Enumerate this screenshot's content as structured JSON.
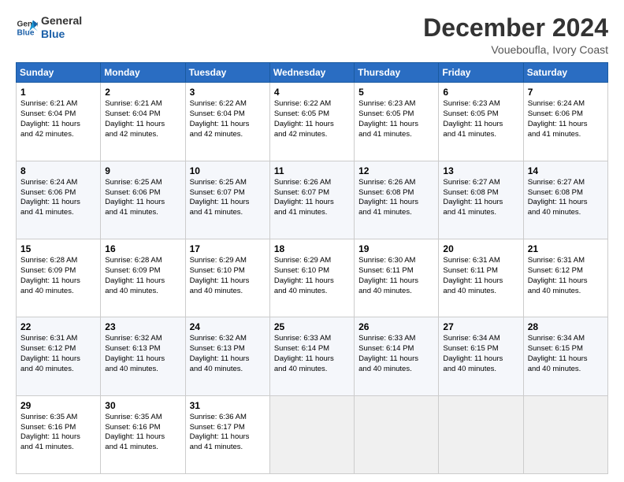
{
  "logo": {
    "line1": "General",
    "line2": "Blue"
  },
  "title": "December 2024",
  "subtitle": "Voueboufla, Ivory Coast",
  "header_days": [
    "Sunday",
    "Monday",
    "Tuesday",
    "Wednesday",
    "Thursday",
    "Friday",
    "Saturday"
  ],
  "weeks": [
    [
      {
        "day": "1",
        "lines": [
          "Sunrise: 6:21 AM",
          "Sunset: 6:04 PM",
          "Daylight: 11 hours",
          "and 42 minutes."
        ]
      },
      {
        "day": "2",
        "lines": [
          "Sunrise: 6:21 AM",
          "Sunset: 6:04 PM",
          "Daylight: 11 hours",
          "and 42 minutes."
        ]
      },
      {
        "day": "3",
        "lines": [
          "Sunrise: 6:22 AM",
          "Sunset: 6:04 PM",
          "Daylight: 11 hours",
          "and 42 minutes."
        ]
      },
      {
        "day": "4",
        "lines": [
          "Sunrise: 6:22 AM",
          "Sunset: 6:05 PM",
          "Daylight: 11 hours",
          "and 42 minutes."
        ]
      },
      {
        "day": "5",
        "lines": [
          "Sunrise: 6:23 AM",
          "Sunset: 6:05 PM",
          "Daylight: 11 hours",
          "and 41 minutes."
        ]
      },
      {
        "day": "6",
        "lines": [
          "Sunrise: 6:23 AM",
          "Sunset: 6:05 PM",
          "Daylight: 11 hours",
          "and 41 minutes."
        ]
      },
      {
        "day": "7",
        "lines": [
          "Sunrise: 6:24 AM",
          "Sunset: 6:06 PM",
          "Daylight: 11 hours",
          "and 41 minutes."
        ]
      }
    ],
    [
      {
        "day": "8",
        "lines": [
          "Sunrise: 6:24 AM",
          "Sunset: 6:06 PM",
          "Daylight: 11 hours",
          "and 41 minutes."
        ]
      },
      {
        "day": "9",
        "lines": [
          "Sunrise: 6:25 AM",
          "Sunset: 6:06 PM",
          "Daylight: 11 hours",
          "and 41 minutes."
        ]
      },
      {
        "day": "10",
        "lines": [
          "Sunrise: 6:25 AM",
          "Sunset: 6:07 PM",
          "Daylight: 11 hours",
          "and 41 minutes."
        ]
      },
      {
        "day": "11",
        "lines": [
          "Sunrise: 6:26 AM",
          "Sunset: 6:07 PM",
          "Daylight: 11 hours",
          "and 41 minutes."
        ]
      },
      {
        "day": "12",
        "lines": [
          "Sunrise: 6:26 AM",
          "Sunset: 6:08 PM",
          "Daylight: 11 hours",
          "and 41 minutes."
        ]
      },
      {
        "day": "13",
        "lines": [
          "Sunrise: 6:27 AM",
          "Sunset: 6:08 PM",
          "Daylight: 11 hours",
          "and 41 minutes."
        ]
      },
      {
        "day": "14",
        "lines": [
          "Sunrise: 6:27 AM",
          "Sunset: 6:08 PM",
          "Daylight: 11 hours",
          "and 40 minutes."
        ]
      }
    ],
    [
      {
        "day": "15",
        "lines": [
          "Sunrise: 6:28 AM",
          "Sunset: 6:09 PM",
          "Daylight: 11 hours",
          "and 40 minutes."
        ]
      },
      {
        "day": "16",
        "lines": [
          "Sunrise: 6:28 AM",
          "Sunset: 6:09 PM",
          "Daylight: 11 hours",
          "and 40 minutes."
        ]
      },
      {
        "day": "17",
        "lines": [
          "Sunrise: 6:29 AM",
          "Sunset: 6:10 PM",
          "Daylight: 11 hours",
          "and 40 minutes."
        ]
      },
      {
        "day": "18",
        "lines": [
          "Sunrise: 6:29 AM",
          "Sunset: 6:10 PM",
          "Daylight: 11 hours",
          "and 40 minutes."
        ]
      },
      {
        "day": "19",
        "lines": [
          "Sunrise: 6:30 AM",
          "Sunset: 6:11 PM",
          "Daylight: 11 hours",
          "and 40 minutes."
        ]
      },
      {
        "day": "20",
        "lines": [
          "Sunrise: 6:31 AM",
          "Sunset: 6:11 PM",
          "Daylight: 11 hours",
          "and 40 minutes."
        ]
      },
      {
        "day": "21",
        "lines": [
          "Sunrise: 6:31 AM",
          "Sunset: 6:12 PM",
          "Daylight: 11 hours",
          "and 40 minutes."
        ]
      }
    ],
    [
      {
        "day": "22",
        "lines": [
          "Sunrise: 6:31 AM",
          "Sunset: 6:12 PM",
          "Daylight: 11 hours",
          "and 40 minutes."
        ]
      },
      {
        "day": "23",
        "lines": [
          "Sunrise: 6:32 AM",
          "Sunset: 6:13 PM",
          "Daylight: 11 hours",
          "and 40 minutes."
        ]
      },
      {
        "day": "24",
        "lines": [
          "Sunrise: 6:32 AM",
          "Sunset: 6:13 PM",
          "Daylight: 11 hours",
          "and 40 minutes."
        ]
      },
      {
        "day": "25",
        "lines": [
          "Sunrise: 6:33 AM",
          "Sunset: 6:14 PM",
          "Daylight: 11 hours",
          "and 40 minutes."
        ]
      },
      {
        "day": "26",
        "lines": [
          "Sunrise: 6:33 AM",
          "Sunset: 6:14 PM",
          "Daylight: 11 hours",
          "and 40 minutes."
        ]
      },
      {
        "day": "27",
        "lines": [
          "Sunrise: 6:34 AM",
          "Sunset: 6:15 PM",
          "Daylight: 11 hours",
          "and 40 minutes."
        ]
      },
      {
        "day": "28",
        "lines": [
          "Sunrise: 6:34 AM",
          "Sunset: 6:15 PM",
          "Daylight: 11 hours",
          "and 40 minutes."
        ]
      }
    ],
    [
      {
        "day": "29",
        "lines": [
          "Sunrise: 6:35 AM",
          "Sunset: 6:16 PM",
          "Daylight: 11 hours",
          "and 41 minutes."
        ]
      },
      {
        "day": "30",
        "lines": [
          "Sunrise: 6:35 AM",
          "Sunset: 6:16 PM",
          "Daylight: 11 hours",
          "and 41 minutes."
        ]
      },
      {
        "day": "31",
        "lines": [
          "Sunrise: 6:36 AM",
          "Sunset: 6:17 PM",
          "Daylight: 11 hours",
          "and 41 minutes."
        ]
      },
      null,
      null,
      null,
      null
    ]
  ]
}
